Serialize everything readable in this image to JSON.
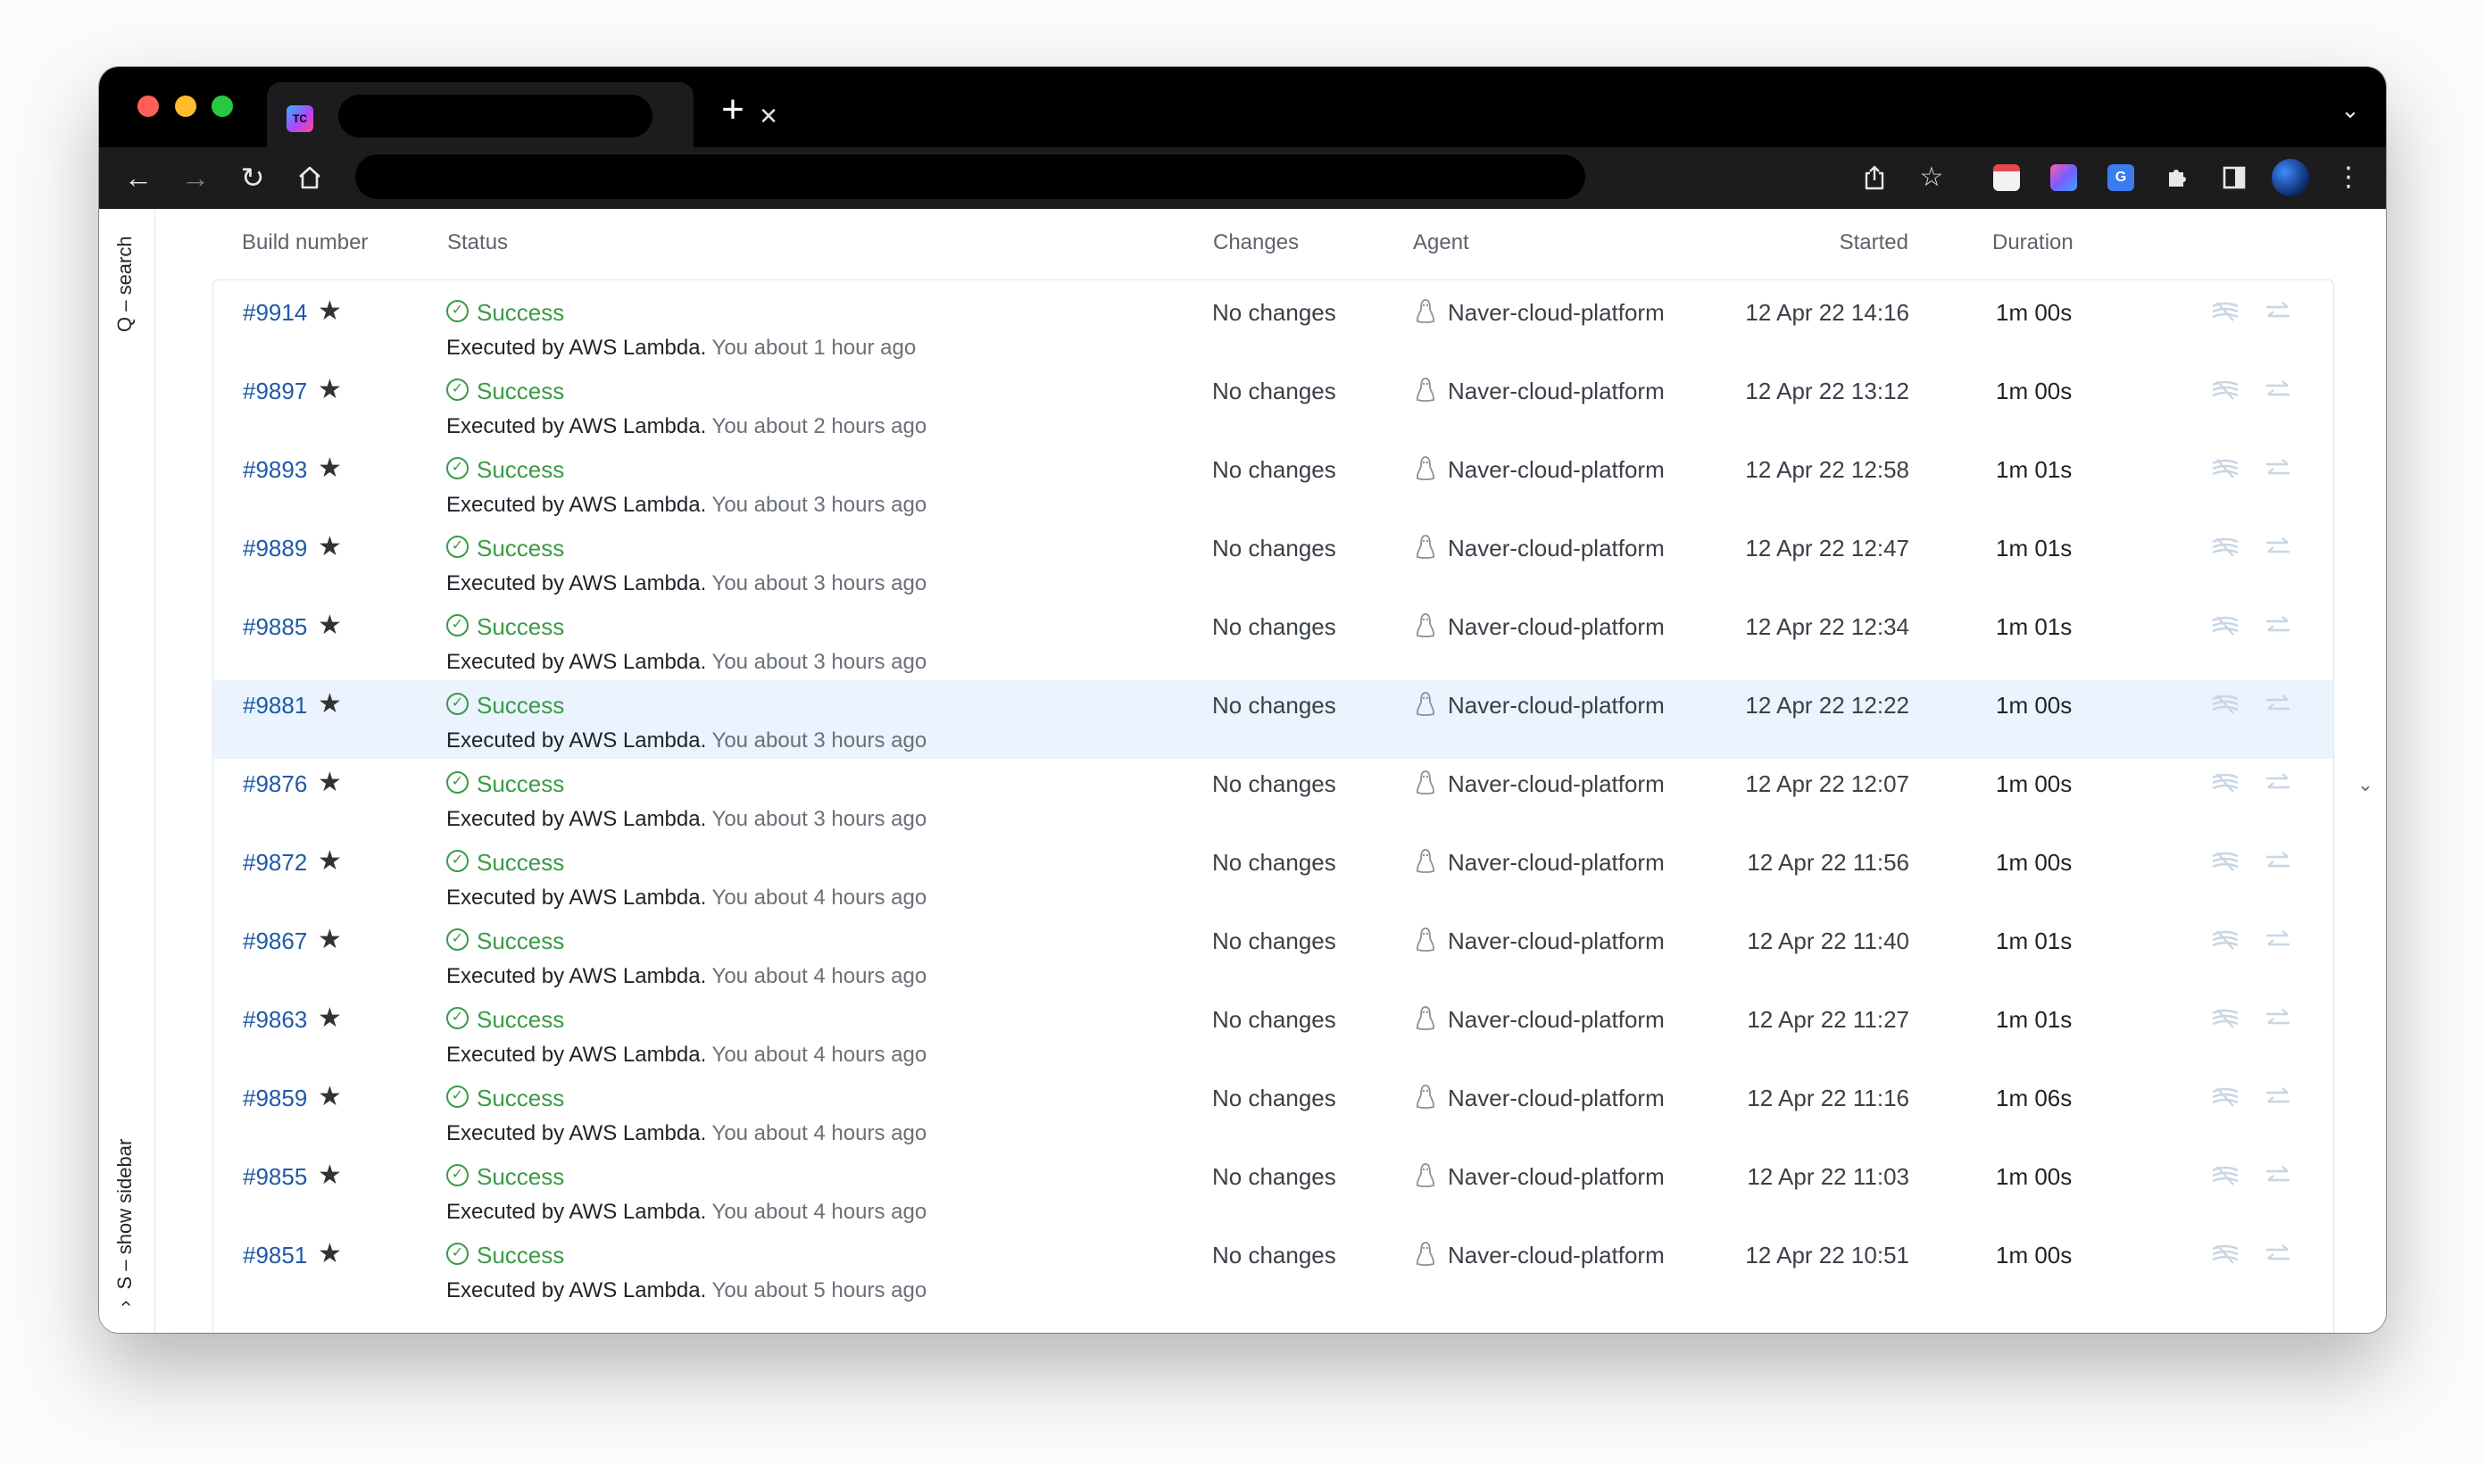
{
  "browser": {
    "tab_title": "",
    "address": "",
    "favicon_text": "TC"
  },
  "rail": {
    "search_hint": "Q – search",
    "sidebar_hint": "S – show sidebar"
  },
  "table": {
    "headers": {
      "build_number": "Build number",
      "status": "Status",
      "changes": "Changes",
      "agent": "Agent",
      "started": "Started",
      "duration": "Duration"
    },
    "rows": [
      {
        "build": "#9914",
        "status": "Success",
        "executed_by": "Executed by AWS Lambda.",
        "ago": "You about 1 hour ago",
        "changes": "No changes",
        "agent": "Naver-cloud-platform",
        "started": "12 Apr 22 14:16",
        "duration": "1m 00s"
      },
      {
        "build": "#9897",
        "status": "Success",
        "executed_by": "Executed by AWS Lambda.",
        "ago": "You about 2 hours ago",
        "changes": "No changes",
        "agent": "Naver-cloud-platform",
        "started": "12 Apr 22 13:12",
        "duration": "1m 00s"
      },
      {
        "build": "#9893",
        "status": "Success",
        "executed_by": "Executed by AWS Lambda.",
        "ago": "You about 3 hours ago",
        "changes": "No changes",
        "agent": "Naver-cloud-platform",
        "started": "12 Apr 22 12:58",
        "duration": "1m 01s"
      },
      {
        "build": "#9889",
        "status": "Success",
        "executed_by": "Executed by AWS Lambda.",
        "ago": "You about 3 hours ago",
        "changes": "No changes",
        "agent": "Naver-cloud-platform",
        "started": "12 Apr 22 12:47",
        "duration": "1m 01s"
      },
      {
        "build": "#9885",
        "status": "Success",
        "executed_by": "Executed by AWS Lambda.",
        "ago": "You about 3 hours ago",
        "changes": "No changes",
        "agent": "Naver-cloud-platform",
        "started": "12 Apr 22 12:34",
        "duration": "1m 01s"
      },
      {
        "build": "#9881",
        "status": "Success",
        "executed_by": "Executed by AWS Lambda.",
        "ago": "You about 3 hours ago",
        "changes": "No changes",
        "agent": "Naver-cloud-platform",
        "started": "12 Apr 22 12:22",
        "duration": "1m 00s"
      },
      {
        "build": "#9876",
        "status": "Success",
        "executed_by": "Executed by AWS Lambda.",
        "ago": "You about 3 hours ago",
        "changes": "No changes",
        "agent": "Naver-cloud-platform",
        "started": "12 Apr 22 12:07",
        "duration": "1m 00s"
      },
      {
        "build": "#9872",
        "status": "Success",
        "executed_by": "Executed by AWS Lambda.",
        "ago": "You about 4 hours ago",
        "changes": "No changes",
        "agent": "Naver-cloud-platform",
        "started": "12 Apr 22 11:56",
        "duration": "1m 00s"
      },
      {
        "build": "#9867",
        "status": "Success",
        "executed_by": "Executed by AWS Lambda.",
        "ago": "You about 4 hours ago",
        "changes": "No changes",
        "agent": "Naver-cloud-platform",
        "started": "12 Apr 22 11:40",
        "duration": "1m 01s"
      },
      {
        "build": "#9863",
        "status": "Success",
        "executed_by": "Executed by AWS Lambda.",
        "ago": "You about 4 hours ago",
        "changes": "No changes",
        "agent": "Naver-cloud-platform",
        "started": "12 Apr 22 11:27",
        "duration": "1m 01s"
      },
      {
        "build": "#9859",
        "status": "Success",
        "executed_by": "Executed by AWS Lambda.",
        "ago": "You about 4 hours ago",
        "changes": "No changes",
        "agent": "Naver-cloud-platform",
        "started": "12 Apr 22 11:16",
        "duration": "1m 06s"
      },
      {
        "build": "#9855",
        "status": "Success",
        "executed_by": "Executed by AWS Lambda.",
        "ago": "You about 4 hours ago",
        "changes": "No changes",
        "agent": "Naver-cloud-platform",
        "started": "12 Apr 22 11:03",
        "duration": "1m 00s"
      },
      {
        "build": "#9851",
        "status": "Success",
        "executed_by": "Executed by AWS Lambda.",
        "ago": "You about 5 hours ago",
        "changes": "No changes",
        "agent": "Naver-cloud-platform",
        "started": "12 Apr 22 10:51",
        "duration": "1m 00s"
      }
    ],
    "highlighted_row": "#9881"
  },
  "colors": {
    "success": "#3a9b45",
    "link": "#1f5aa8",
    "highlight_row": "#eaf3fe",
    "chrome_bg": "#1c1c1e"
  },
  "icons": {
    "status": "check-circle-icon",
    "star": "star-icon",
    "agent": "linux-penguin-icon",
    "row_action_1": "stack-layers-icon",
    "row_action_2": "compare-arrows-icon"
  }
}
